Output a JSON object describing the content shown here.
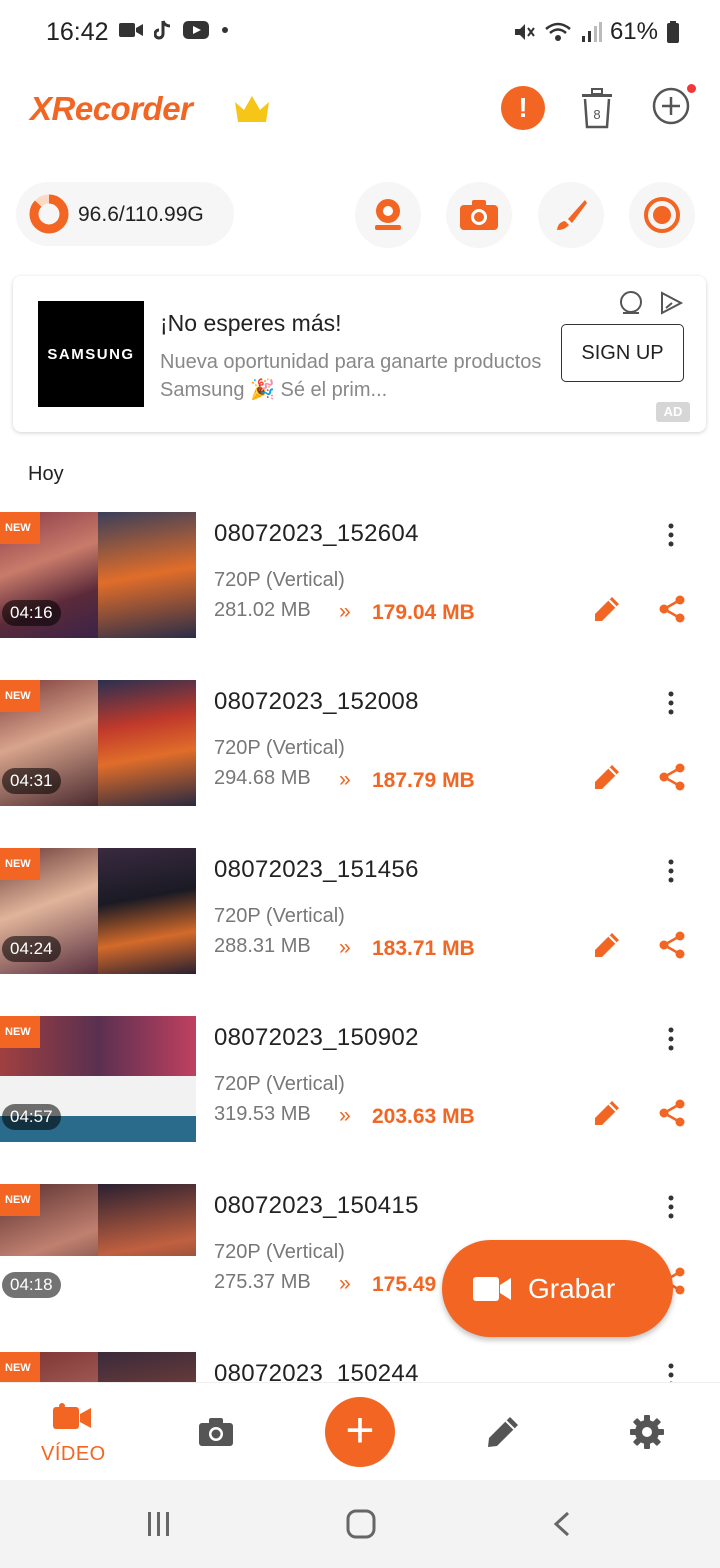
{
  "status_bar": {
    "time": "16:42",
    "battery": "61%",
    "left_icons": [
      "video-call-icon",
      "tiktok-icon",
      "youtube-icon",
      "dot-icon"
    ],
    "right_icons": [
      "mute-icon",
      "wifi-icon",
      "signal-icon",
      "battery-icon"
    ]
  },
  "app_bar": {
    "title": "XRecorder",
    "trash_count": "8"
  },
  "storage": {
    "text": "96.6/110.99G",
    "used_fraction": 0.87
  },
  "ad": {
    "brand": "SAMSUNG",
    "title": "¡No esperes más!",
    "description": "Nueva oportunidad para ganarte productos Samsung 🎉 Sé el prim...",
    "cta": "SIGN UP",
    "badge": "AD"
  },
  "section": {
    "label": "Hoy"
  },
  "videos": [
    {
      "new": "NEW",
      "duration": "04:16",
      "name": "08072023_152604",
      "resolution": "720P (Vertical)",
      "size": "281.02 MB",
      "compressed": "179.04 MB"
    },
    {
      "new": "NEW",
      "duration": "04:31",
      "name": "08072023_152008",
      "resolution": "720P (Vertical)",
      "size": "294.68 MB",
      "compressed": "187.79 MB"
    },
    {
      "new": "NEW",
      "duration": "04:24",
      "name": "08072023_151456",
      "resolution": "720P (Vertical)",
      "size": "288.31 MB",
      "compressed": "183.71 MB"
    },
    {
      "new": "NEW",
      "duration": "04:57",
      "name": "08072023_150902",
      "resolution": "720P (Vertical)",
      "size": "319.53 MB",
      "compressed": "203.63 MB"
    },
    {
      "new": "NEW",
      "duration": "04:18",
      "name": "08072023_150415",
      "resolution": "720P (Vertical)",
      "size": "275.37 MB",
      "compressed": "175.49"
    },
    {
      "new": "NEW",
      "duration": "",
      "name": "08072023_150244",
      "resolution": "",
      "size": "",
      "compressed": ""
    }
  ],
  "fab": {
    "label": "Grabar"
  },
  "bottom_nav": {
    "video_label": "VÍDEO",
    "plus": "+"
  },
  "colors": {
    "accent": "#f26522",
    "crown": "#f5c518"
  }
}
